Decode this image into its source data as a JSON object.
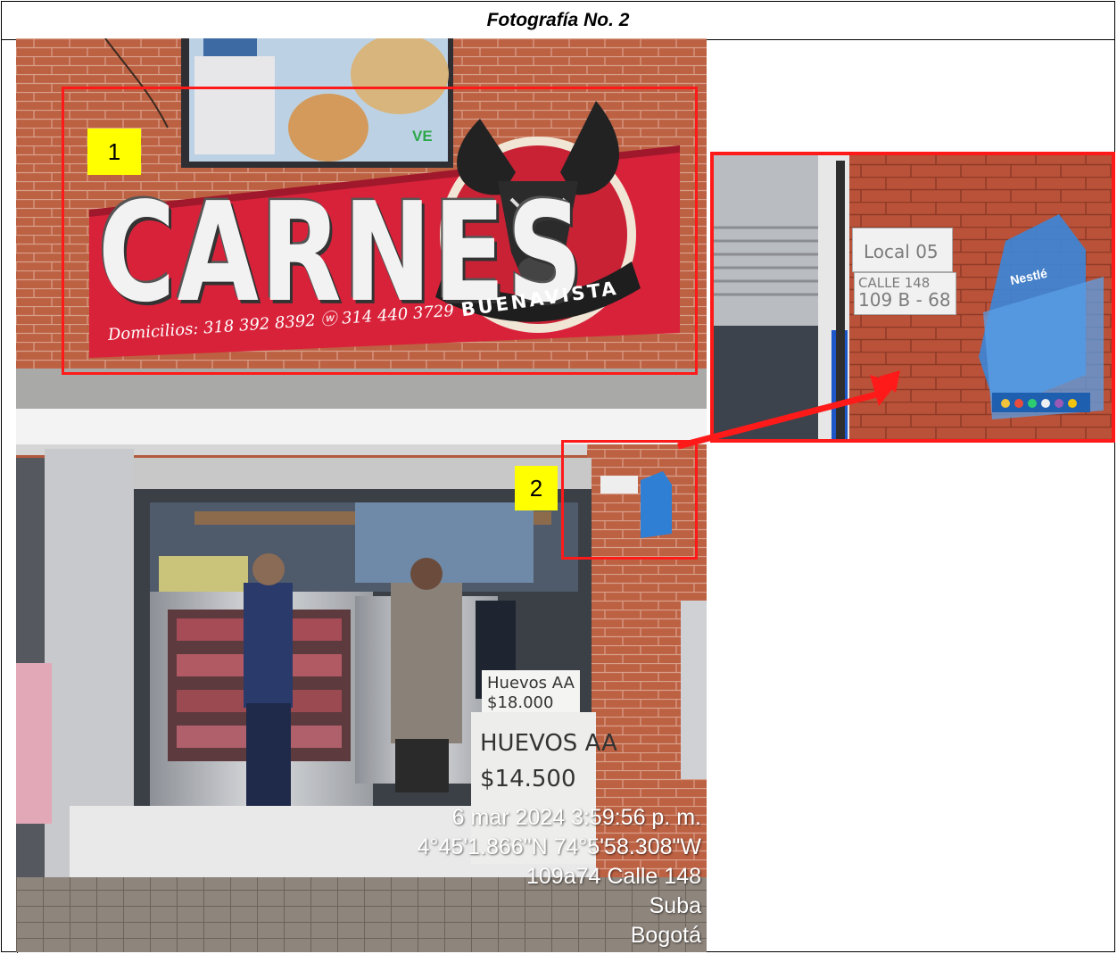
{
  "caption": "Fotografía No. 2",
  "labels": {
    "one": "1",
    "two": "2"
  },
  "sign": {
    "brand": "CARNES",
    "sub_brand": "BUENAVISTA",
    "phones": "Domicilios: 318 392 8392 ⓦ 314 440 3729",
    "window_logo": "VE"
  },
  "plate": {
    "local": "Local 05",
    "street": "CALLE 148",
    "number": "109 B - 68"
  },
  "nestle_logo": "Nestlé",
  "egg_signs": {
    "sign_top_line1": "Huevos AA",
    "sign_top_line2": "$18.000",
    "sign_bottom_line1": "HUEVOS AA",
    "sign_bottom_line2": "$14.500"
  },
  "stamp": {
    "datetime": "6 mar 2024 3:59:56 p. m.",
    "coordinates": "4°45'1.866\"N  74°5'58.308\"W",
    "address": "109a74 Calle 148",
    "locality": "Suba",
    "city": "Bogotá"
  },
  "colors": {
    "highlight_red": "#ff1a1a",
    "label_yellow": "#ffff00",
    "sign_red": "#d8223a",
    "brick": "#b35a3e"
  }
}
